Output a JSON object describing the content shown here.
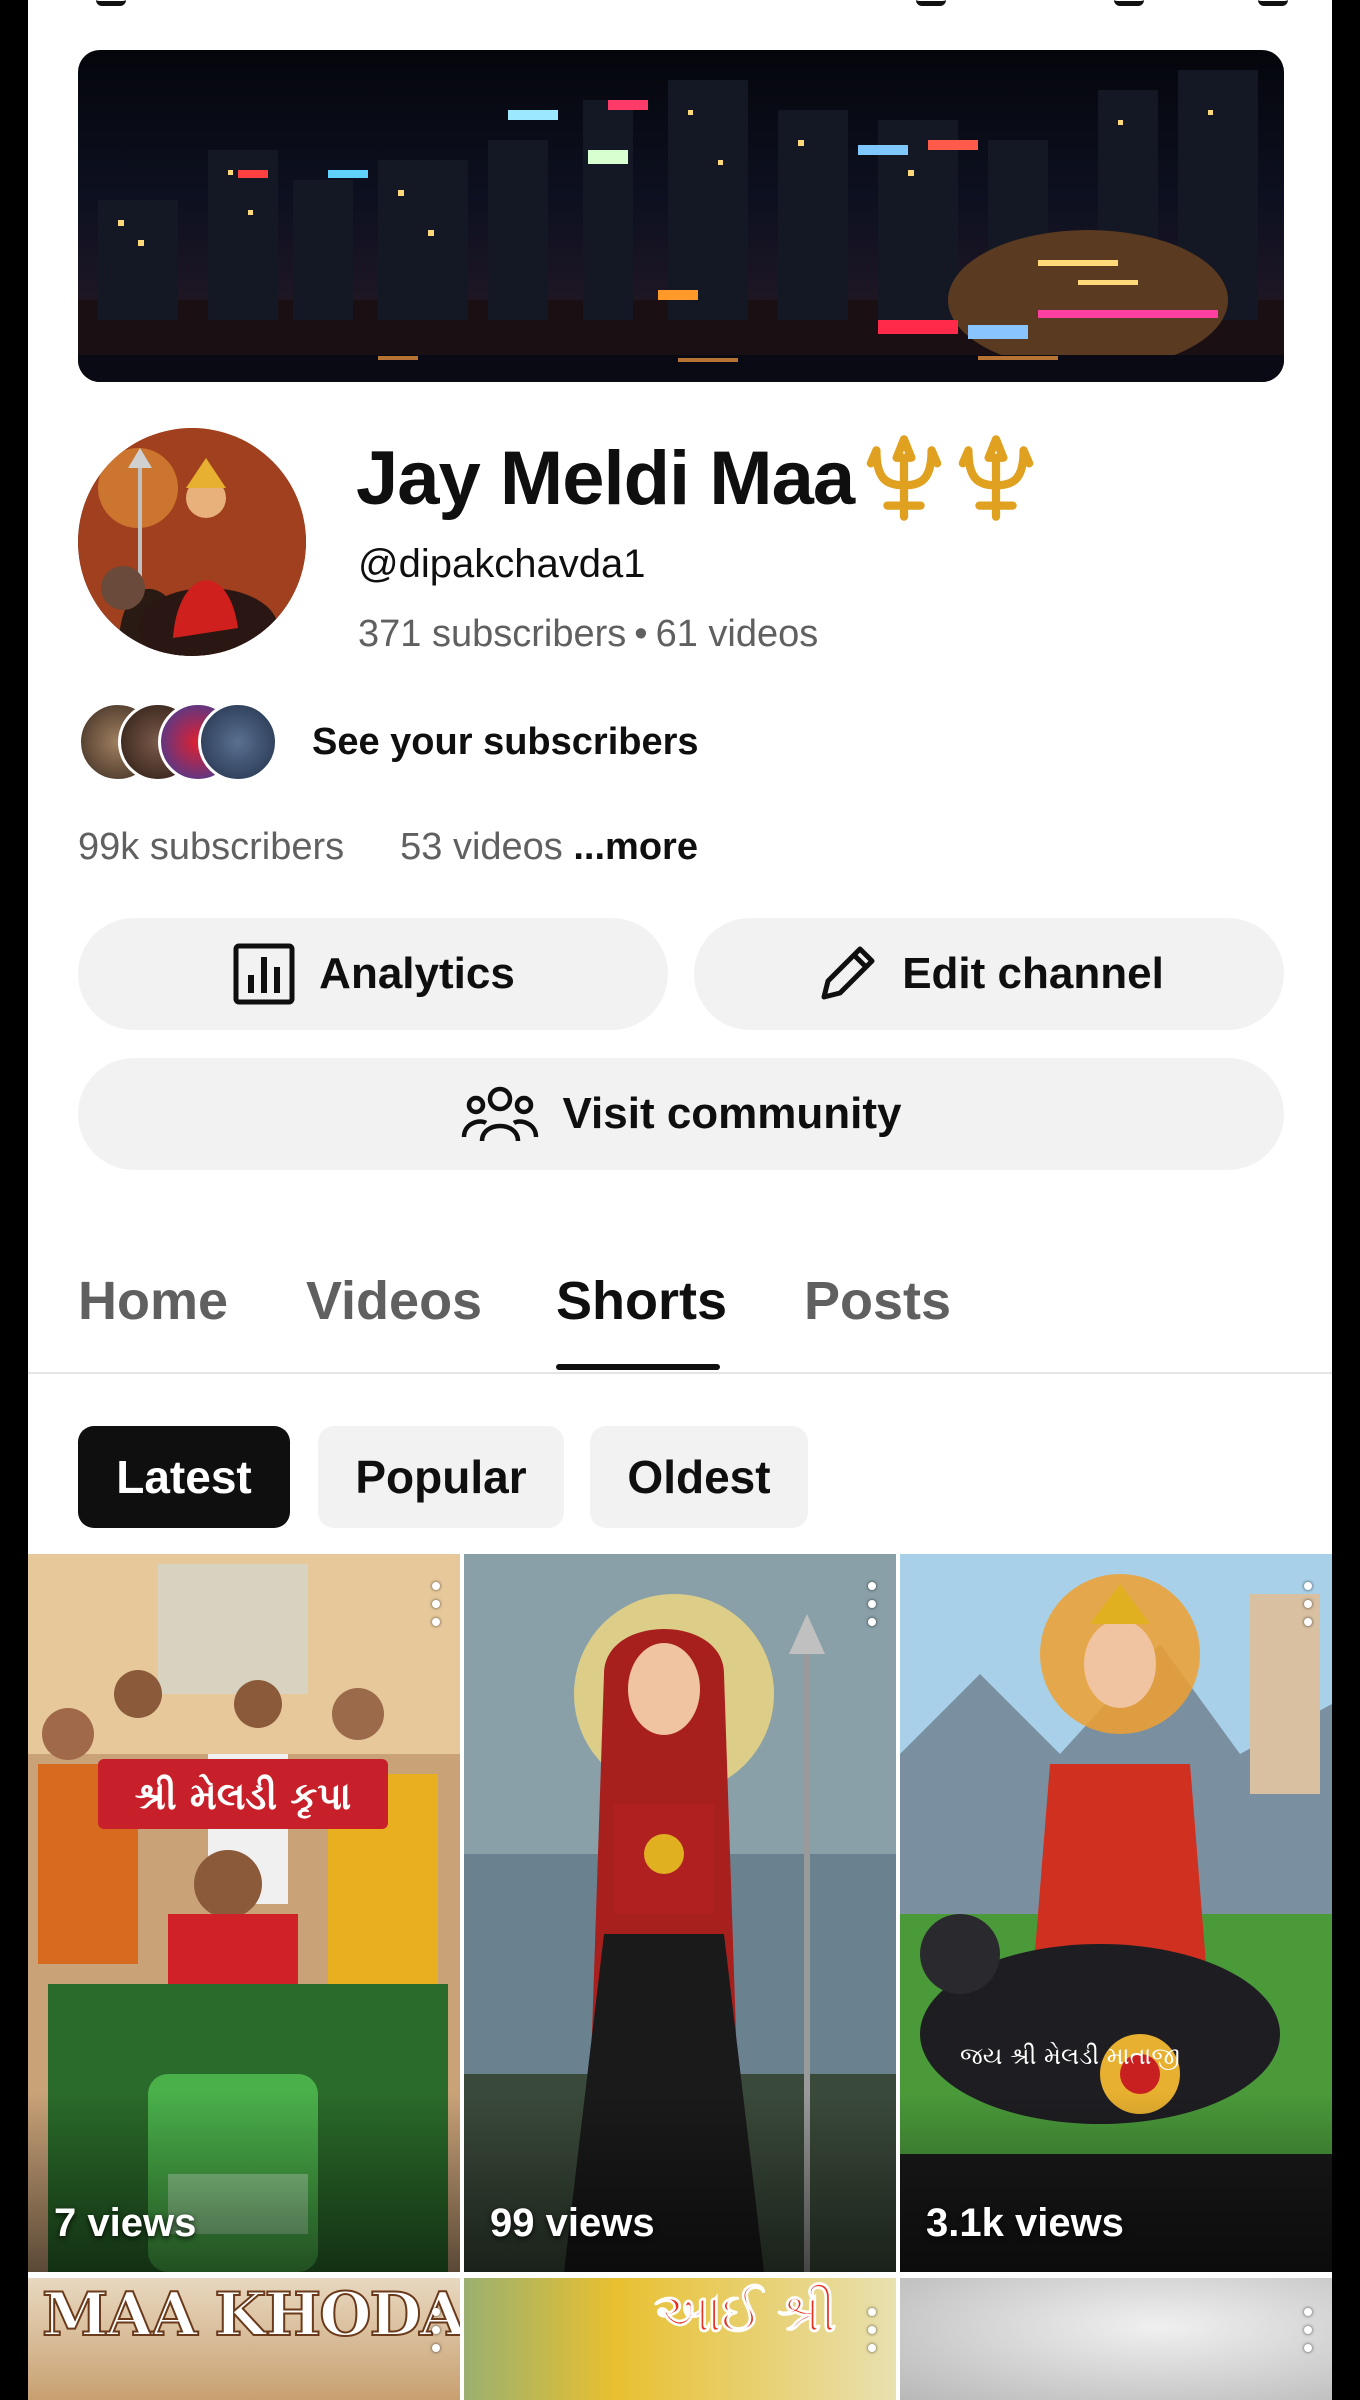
{
  "channel": {
    "title": "Jay Meldi Maa",
    "title_icons": [
      "trident-icon",
      "trident-icon"
    ],
    "handle": "@dipakchavda1",
    "subscribers": "371 subscribers",
    "separator": "•",
    "videos": "61 videos",
    "see_subscribers_label": "See your subscribers",
    "about_subscribers": "99k subscribers",
    "about_videos": "53 videos",
    "about_more": "...more"
  },
  "actions": {
    "analytics_label": "Analytics",
    "analytics_icon": "bar-chart-icon",
    "edit_label": "Edit channel",
    "edit_icon": "pencil-icon",
    "community_label": "Visit community",
    "community_icon": "people-icon"
  },
  "tabs": [
    {
      "label": "Home",
      "active": false
    },
    {
      "label": "Videos",
      "active": false
    },
    {
      "label": "Shorts",
      "active": true
    },
    {
      "label": "Posts",
      "active": false
    }
  ],
  "chips": [
    {
      "label": "Latest",
      "selected": true
    },
    {
      "label": "Popular",
      "selected": false
    },
    {
      "label": "Oldest",
      "selected": false
    }
  ],
  "shorts": [
    {
      "views": "7 views",
      "banner_text": "શ્રી મેલડી કૃપા"
    },
    {
      "views": "99 views"
    },
    {
      "views": "3.1k views",
      "caption": "જય શ્રી મેલડી માતાજી"
    }
  ],
  "shorts_row2": [
    {
      "caption": "MAA KHODA"
    },
    {
      "caption": "આઈ શ્રી"
    },
    {
      "caption": ""
    }
  ],
  "colors": {
    "accent": "#0f0f0f",
    "muted": "#606060",
    "chip_bg": "#f2f2f2",
    "trident": "#e0a020"
  }
}
